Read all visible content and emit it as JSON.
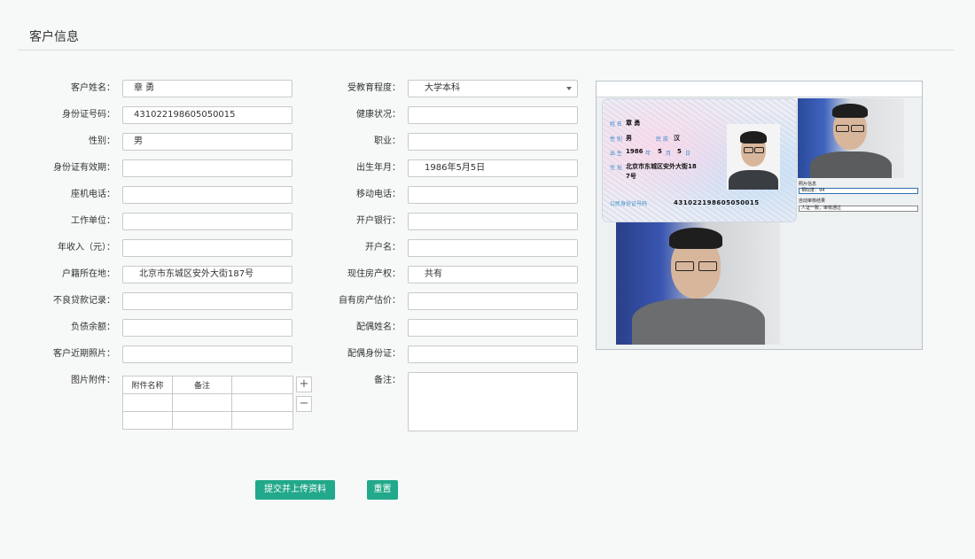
{
  "page": {
    "title": "客户信息"
  },
  "left_fields": [
    {
      "label": "客户姓名：",
      "value": "章 勇"
    },
    {
      "label": "身份证号码：",
      "value": "431022198605050015"
    },
    {
      "label": "性别：",
      "value": "男"
    },
    {
      "label": "身份证有效期：",
      "value": ""
    },
    {
      "label": "座机电话：",
      "value": ""
    },
    {
      "label": "工作单位：",
      "value": ""
    },
    {
      "label": "年收入（元）：",
      "value": ""
    },
    {
      "label": "户籍所在地：",
      "value": "北京市东城区安外大街187号"
    },
    {
      "label": "不良贷款记录：",
      "value": ""
    },
    {
      "label": "负债余额：",
      "value": ""
    },
    {
      "label": "客户近期照片：",
      "value": ""
    }
  ],
  "right_fields": [
    {
      "label": "受教育程度：",
      "value": "大学本科"
    },
    {
      "label": "健康状况：",
      "value": ""
    },
    {
      "label": "职业：",
      "value": ""
    },
    {
      "label": "出生年月：",
      "value": "1986年5月5日"
    },
    {
      "label": "移动电话：",
      "value": ""
    },
    {
      "label": "开户银行：",
      "value": ""
    },
    {
      "label": "开户名：",
      "value": ""
    },
    {
      "label": "现住房产权：",
      "value": "共有"
    },
    {
      "label": "自有房产估价：",
      "value": ""
    },
    {
      "label": "配偶姓名：",
      "value": ""
    },
    {
      "label": "配偶身份证：",
      "value": ""
    }
  ],
  "attachments": {
    "label": "图片附件：",
    "headers": [
      "附件名称",
      "备注",
      ""
    ],
    "add_symbol": "+",
    "remove_symbol": "−"
  },
  "notes": {
    "label": "备注："
  },
  "buttons": {
    "submit": "提交并上传资料",
    "reset": "重置"
  },
  "id_card": {
    "name_label": "姓 名",
    "name": "章 勇",
    "gender_label": "性 别",
    "gender": "男",
    "ethnic_label": "民 族",
    "ethnic": "汉",
    "birth_label": "出 生",
    "birth_year": "1986",
    "birth_year_label": "年",
    "birth_month": "5",
    "birth_month_label": "月",
    "birth_day": "5",
    "birth_day_label": "日",
    "address_label": "住 址",
    "address_line1": "北京市东城区安外大街18",
    "address_line2": "7号",
    "id_label": "公民身份证号码",
    "id_number": "431022198605050015"
  },
  "verify": {
    "photo_info_label": "照片信息",
    "similarity": "相似度：94",
    "auto_review_label": "自动审核结果",
    "result": "人证一致，审核通过"
  },
  "colors": {
    "accent": "#22a88a",
    "background": "#f7f8f8",
    "border": "#c9c9c9"
  }
}
